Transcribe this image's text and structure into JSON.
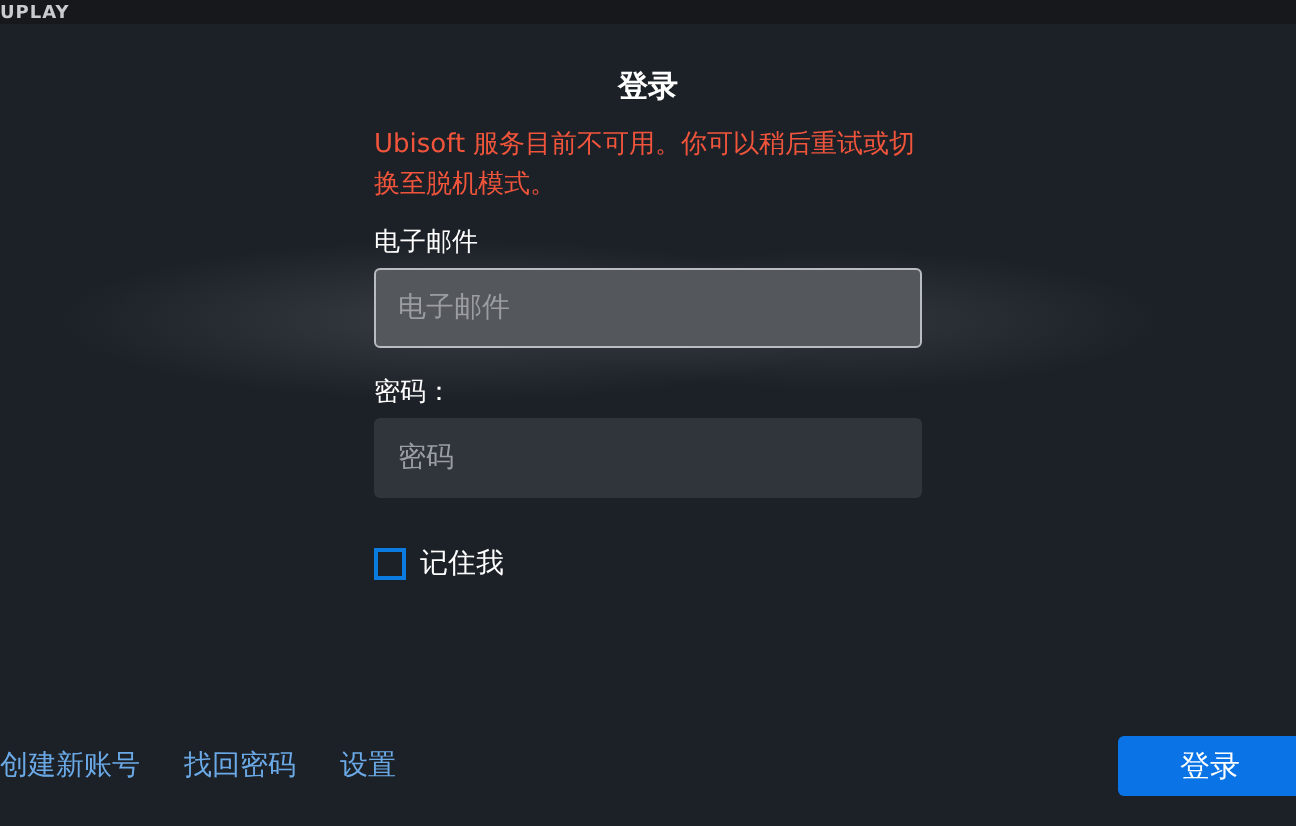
{
  "top_bar": {
    "logo": "UPLAY"
  },
  "title": "登录",
  "error": "Ubisoft 服务目前不可用。你可以稍后重试或切换至脱机模式。",
  "email": {
    "label": "电子邮件",
    "placeholder": "电子邮件",
    "focused": true
  },
  "password": {
    "label": "密码：",
    "placeholder": "密码",
    "focused": false
  },
  "remember": {
    "label": "记住我",
    "checked": false
  },
  "links": [
    "创建新账号",
    "找回密码",
    "设置"
  ],
  "submit": "登录"
}
